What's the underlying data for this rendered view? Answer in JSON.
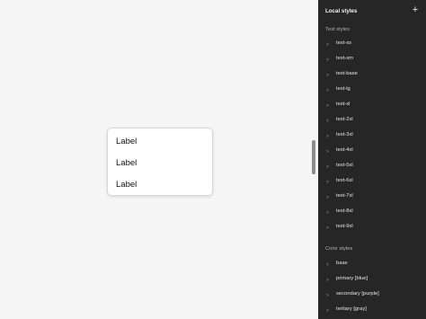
{
  "canvas": {
    "card_items": [
      "Label",
      "Label",
      "Label"
    ]
  },
  "panel": {
    "title": "Local styles",
    "add_icon": "plus-icon",
    "text_styles": {
      "title": "Text styles",
      "items": [
        "text-xs",
        "text-sm",
        "text-base",
        "text-lg",
        "text-xl",
        "text-2xl",
        "text-3xl",
        "text-4xl",
        "text-5xl",
        "text-6xl",
        "text-7xl",
        "text-8xl",
        "text-9xl"
      ]
    },
    "color_styles": {
      "title": "Color styles",
      "items": [
        "base",
        "primary [blue]",
        "secondary [purple]",
        "tertiary [gray]"
      ]
    }
  }
}
